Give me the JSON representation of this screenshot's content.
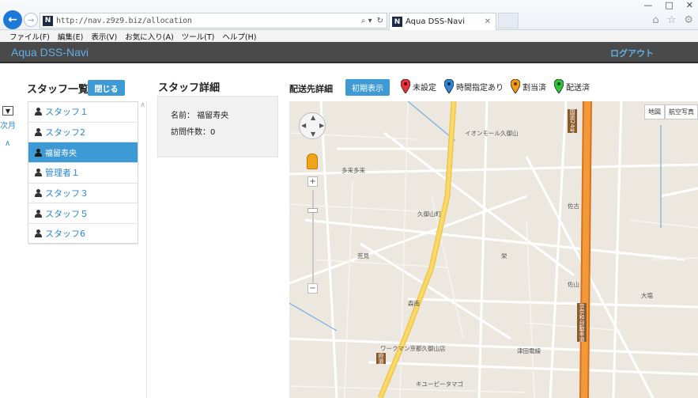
{
  "browser": {
    "url": "http://nav.z9z9.biz/allocation",
    "favicon_letter": "N",
    "tab_title": "Aqua DSS-Navi",
    "search_glyph": "⌕ ▾",
    "refresh_glyph": "↻"
  },
  "menu": [
    "ファイル(F)",
    "編集(E)",
    "表示(V)",
    "お気に入り(A)",
    "ツール(T)",
    "ヘルプ(H)"
  ],
  "app": {
    "brand": "Aqua DSS-Navi",
    "logout": "ログアウト"
  },
  "rail": {
    "label": "次月"
  },
  "staff": {
    "title": "スタッフ一覧",
    "close_button": "閉じる",
    "items": [
      {
        "label": "スタッフ１",
        "active": false
      },
      {
        "label": "スタッフ2",
        "active": false
      },
      {
        "label": "福留寿央",
        "active": true
      },
      {
        "label": "管理者１",
        "active": false
      },
      {
        "label": "スタッフ３",
        "active": false
      },
      {
        "label": "スタッフ５",
        "active": false
      },
      {
        "label": "スタッフ6",
        "active": false
      }
    ]
  },
  "detail": {
    "title": "スタッフ詳細",
    "name_line": "名前： 福留寿央",
    "visits_line": "訪問件数：0"
  },
  "delivery": {
    "title": "配送先詳細",
    "init_button": "初期表示",
    "legend": [
      {
        "label": "未設定",
        "color": "#e8313a"
      },
      {
        "label": "時間指定あり",
        "color": "#2f86d8"
      },
      {
        "label": "割当済",
        "color": "#f09a1c"
      },
      {
        "label": "配送済",
        "color": "#2fc43a"
      }
    ]
  },
  "map": {
    "type_buttons": [
      "地図",
      "航空写真"
    ],
    "labels": [
      "イオンモール久御山",
      "多来多来",
      "久御山町",
      "佐古",
      "荒見",
      "森南",
      "ワークマン京都久御山店",
      "津田電線",
      "キユーピータマゴ",
      "佐山",
      "大塩",
      "栄"
    ],
    "road_labels": [
      "国道24号",
      "京奈和自動車道",
      "府道"
    ]
  }
}
